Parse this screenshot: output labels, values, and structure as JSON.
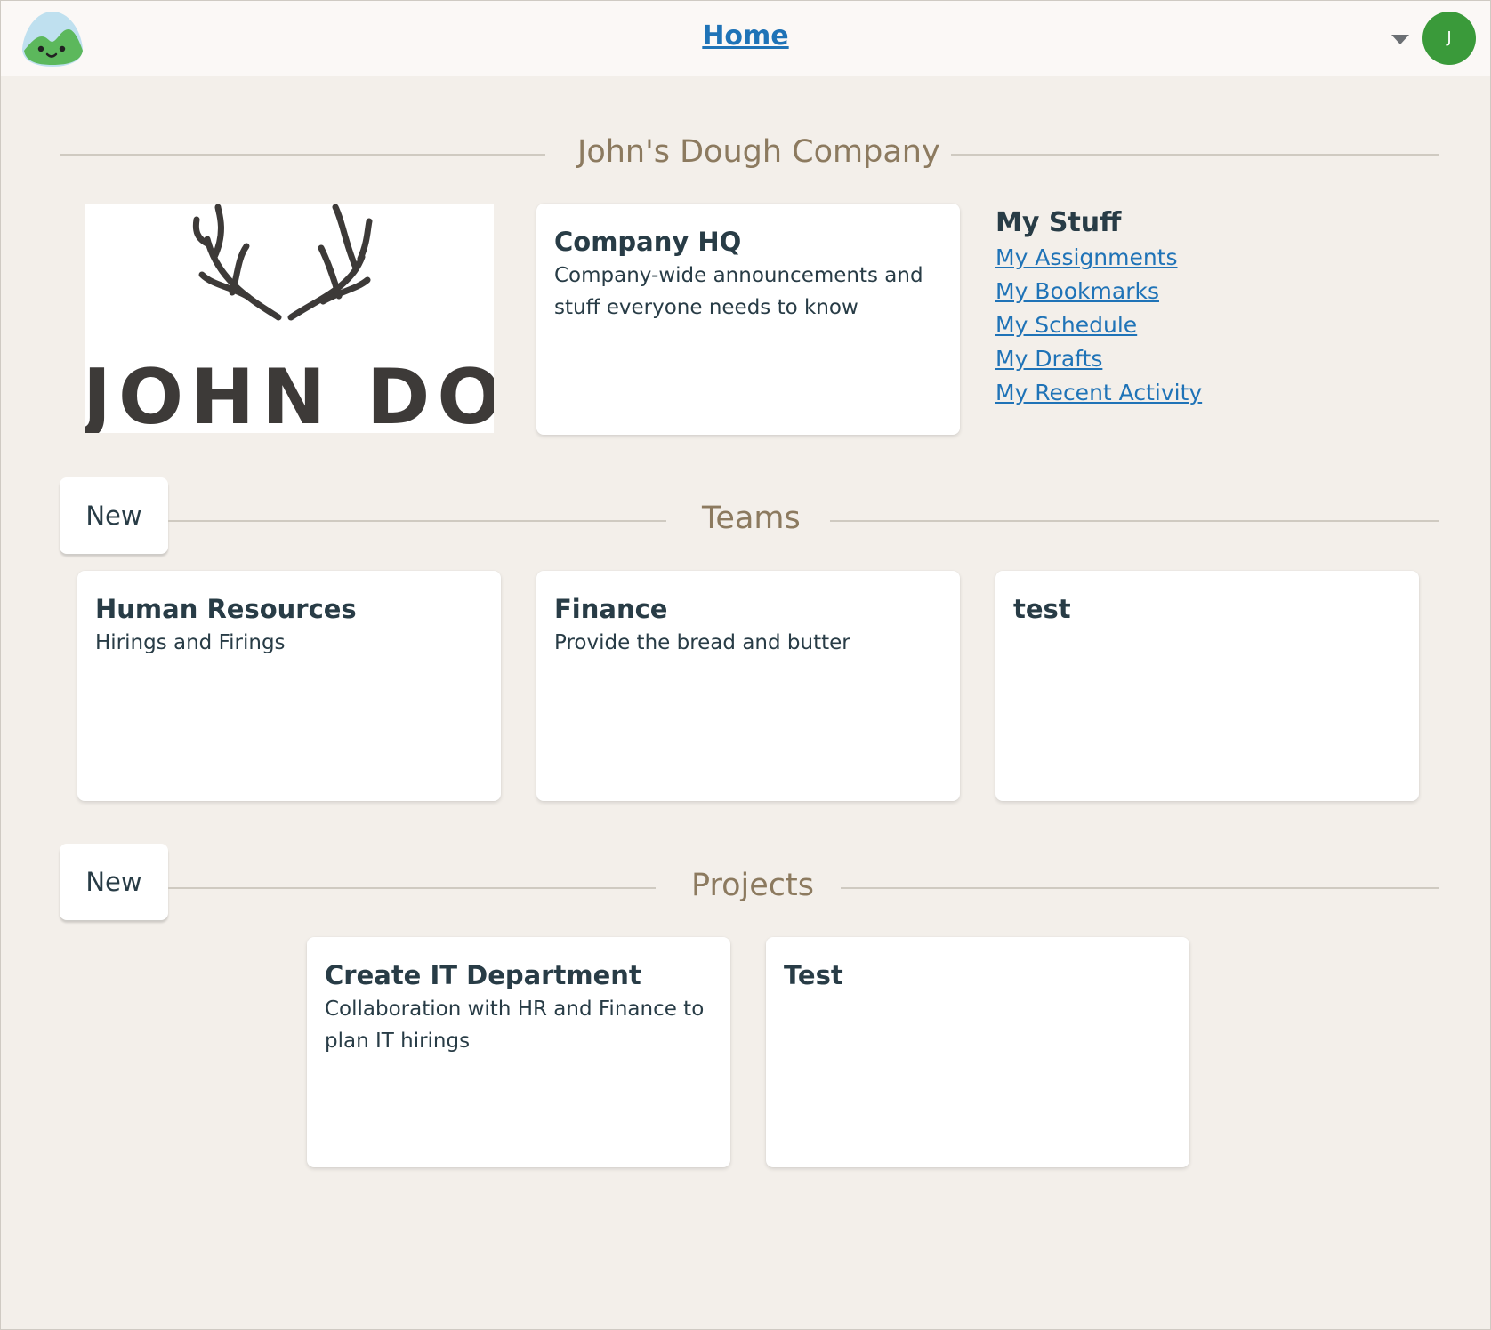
{
  "header": {
    "home_label": "Home",
    "avatar_initial": "J"
  },
  "company": {
    "name": "John's Dough Company",
    "logo_text": "JOHN DOE",
    "hq": {
      "title": "Company HQ",
      "description": "Company-wide announcements and stuff everyone needs to know"
    }
  },
  "my_stuff": {
    "heading": "My Stuff",
    "links": [
      "My Assignments",
      "My Bookmarks",
      "My Schedule",
      "My Drafts",
      "My Recent Activity"
    ]
  },
  "teams": {
    "title": "Teams",
    "new_label": "New",
    "items": [
      {
        "title": "Human Resources",
        "description": "Hirings and Firings"
      },
      {
        "title": "Finance",
        "description": "Provide the bread and butter"
      },
      {
        "title": "test",
        "description": ""
      }
    ]
  },
  "projects": {
    "title": "Projects",
    "new_label": "New",
    "items": [
      {
        "title": "Create IT Department",
        "description": "Collaboration with HR and Finance to plan IT hirings"
      },
      {
        "title": "Test",
        "description": ""
      }
    ]
  },
  "colors": {
    "page_background": "#f3efea",
    "link": "#1f73b7",
    "section_title": "#8c7a5f",
    "avatar": "#3a9a3a"
  }
}
